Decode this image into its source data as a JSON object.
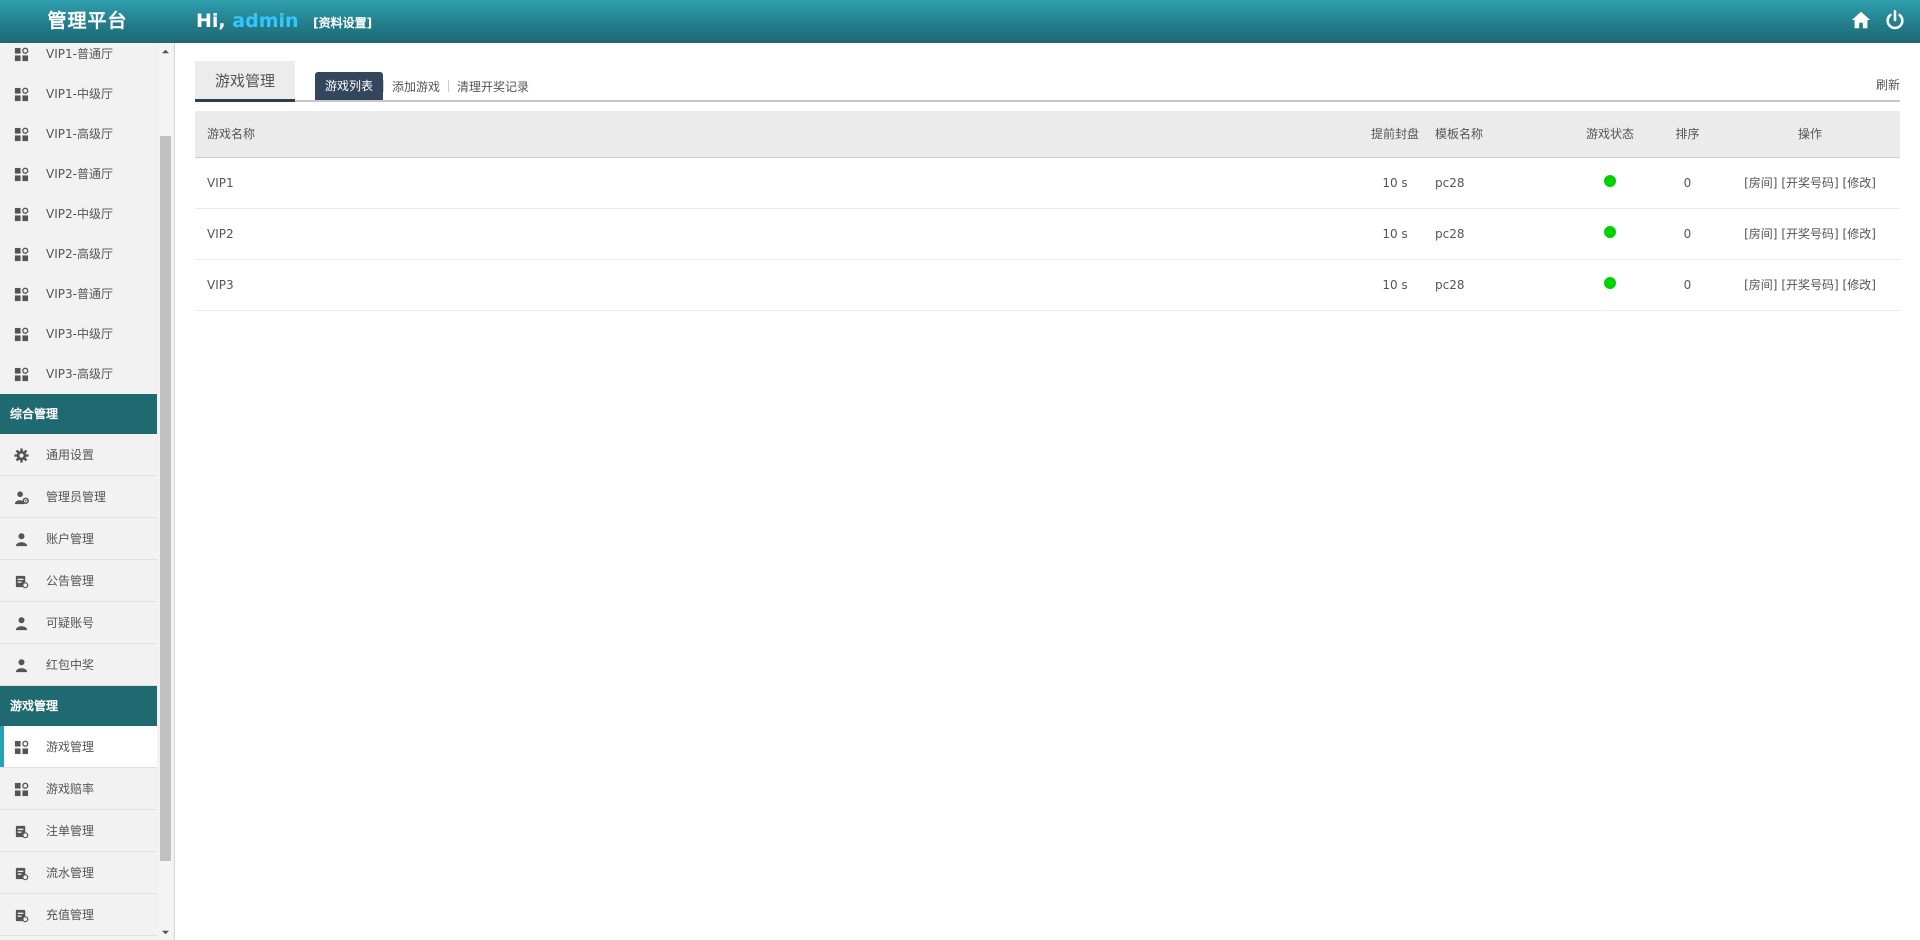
{
  "header": {
    "brand": "管理平台",
    "greeting": "Hi,",
    "username": "admin",
    "profile_link": "[资料设置]"
  },
  "sidebar": {
    "items_top": [
      {
        "label": "VIP1-普通厅",
        "icon": "apps-icon"
      },
      {
        "label": "VIP1-中级厅",
        "icon": "apps-icon"
      },
      {
        "label": "VIP1-高级厅",
        "icon": "apps-icon"
      },
      {
        "label": "VIP2-普通厅",
        "icon": "apps-icon"
      },
      {
        "label": "VIP2-中级厅",
        "icon": "apps-icon"
      },
      {
        "label": "VIP2-高级厅",
        "icon": "apps-icon"
      },
      {
        "label": "VIP3-普通厅",
        "icon": "apps-icon"
      },
      {
        "label": "VIP3-中级厅",
        "icon": "apps-icon"
      },
      {
        "label": "VIP3-高级厅",
        "icon": "apps-icon"
      }
    ],
    "section1": {
      "title": "综合管理",
      "items": [
        {
          "label": "通用设置",
          "icon": "gear-icon"
        },
        {
          "label": "管理员管理",
          "icon": "user-gear-icon"
        },
        {
          "label": "账户管理",
          "icon": "user-icon"
        },
        {
          "label": "公告管理",
          "icon": "document-icon"
        },
        {
          "label": "可疑账号",
          "icon": "user-icon"
        },
        {
          "label": "红包中奖",
          "icon": "user-icon"
        }
      ]
    },
    "section2": {
      "title": "游戏管理",
      "items": [
        {
          "label": "游戏管理",
          "icon": "apps-icon",
          "active": true
        },
        {
          "label": "游戏赔率",
          "icon": "apps-icon"
        },
        {
          "label": "注单管理",
          "icon": "document-icon"
        },
        {
          "label": "流水管理",
          "icon": "document-icon"
        },
        {
          "label": "充值管理",
          "icon": "document-icon"
        }
      ]
    }
  },
  "main": {
    "title": "游戏管理",
    "tabs": [
      {
        "label": "游戏列表",
        "active": true
      },
      {
        "label": "添加游戏"
      },
      {
        "label": "清理开奖记录"
      }
    ],
    "refresh_label": "刷新",
    "table": {
      "columns": [
        "游戏名称",
        "提前封盘",
        "模板名称",
        "游戏状态",
        "排序",
        "操作"
      ],
      "rows": [
        {
          "name": "VIP1",
          "close_ahead": "10 s",
          "template": "pc28",
          "status": "enabled",
          "sort": "0",
          "actions": [
            "[房间]",
            "[开奖号码]",
            "[修改]"
          ]
        },
        {
          "name": "VIP2",
          "close_ahead": "10 s",
          "template": "pc28",
          "status": "enabled",
          "sort": "0",
          "actions": [
            "[房间]",
            "[开奖号码]",
            "[修改]"
          ]
        },
        {
          "name": "VIP3",
          "close_ahead": "10 s",
          "template": "pc28",
          "status": "enabled",
          "sort": "0",
          "actions": [
            "[房间]",
            "[开奖号码]",
            "[修改]"
          ]
        }
      ]
    }
  },
  "colors": {
    "topbar": "#237b88",
    "section_header": "#1f6a70",
    "active_tab": "#33465e",
    "username": "#33c6ff",
    "status_on": "#00d100"
  }
}
